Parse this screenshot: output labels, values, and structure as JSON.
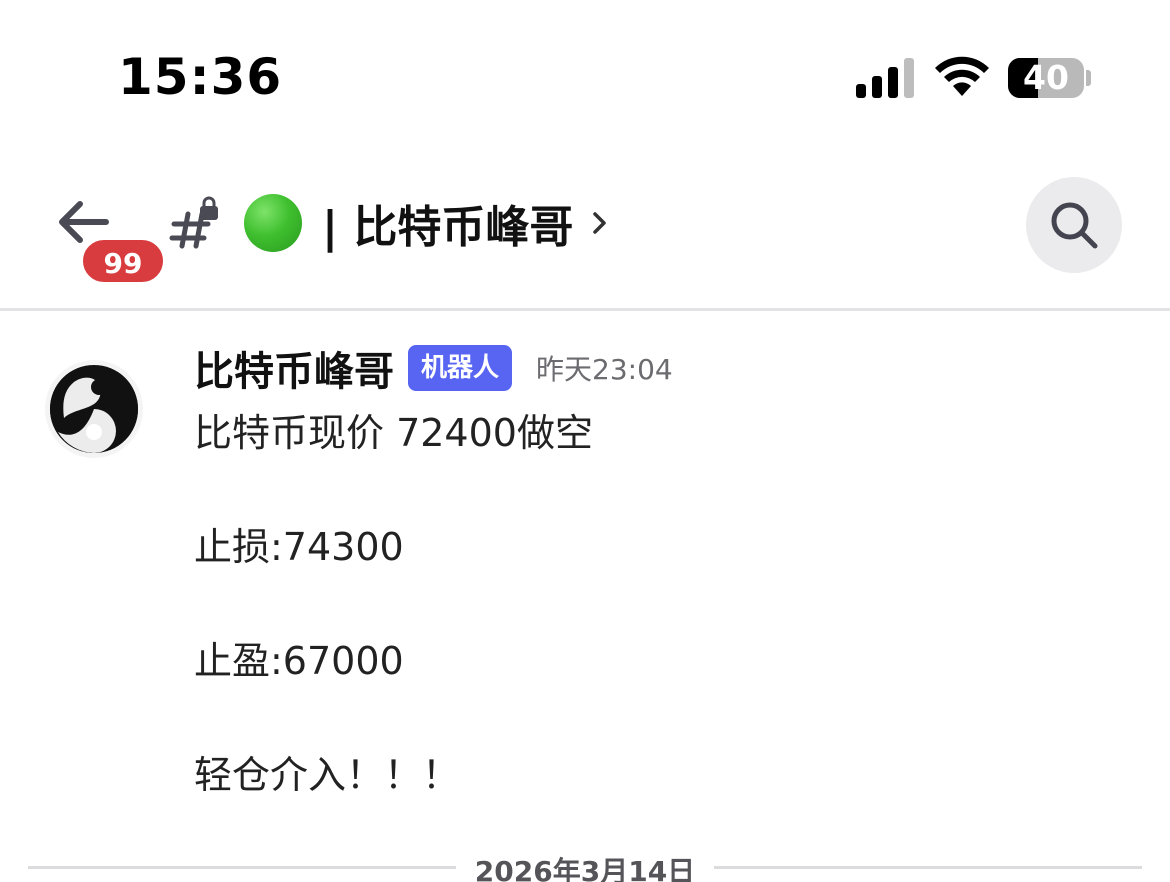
{
  "status_bar": {
    "time": "15:36",
    "battery_level": 40,
    "battery_label": "40"
  },
  "header": {
    "unread_count": "99",
    "channel_title": "| 比特币峰哥",
    "status_color": "#3fbf2f"
  },
  "message": {
    "author": "比特币峰哥",
    "bot_tag": "机器人",
    "timestamp": "昨天23:04",
    "lines": [
      "比特币现价 72400做空",
      "止损:74300",
      "止盈:67000",
      "轻仓介入！！！"
    ]
  },
  "date_divider": "2026年3月14日",
  "colors": {
    "badge": "#d83c3e",
    "bot_tag": "#5865f2"
  },
  "icons": {
    "back": "arrow-left-icon",
    "channel": "locked-hashtag-icon",
    "search": "search-icon",
    "chevron": "chevron-right-icon"
  }
}
